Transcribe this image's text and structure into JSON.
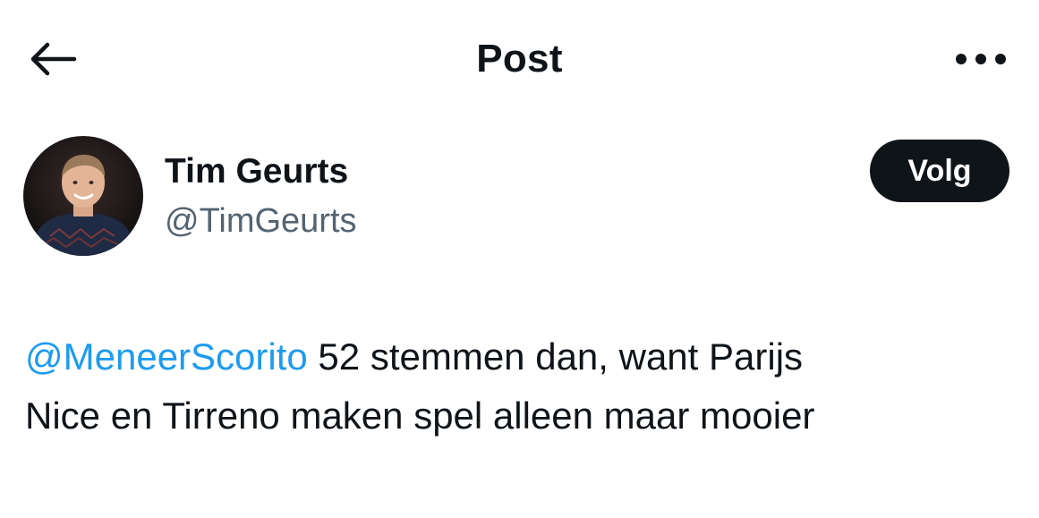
{
  "header": {
    "back_icon": "arrow-left-icon",
    "title": "Post",
    "more_icon": "more-horizontal-icon"
  },
  "author": {
    "avatar_icon": "user-avatar",
    "display_name": "Tim Geurts",
    "handle": "@TimGeurts",
    "follow_label": "Volg"
  },
  "post": {
    "mention": "@MeneerScorito",
    "text_line1": " 52 stemmen dan, want Parijs",
    "text_line2": "Nice en Tirreno maken spel alleen maar mooier"
  },
  "colors": {
    "text": "#0f1419",
    "secondary": "#536471",
    "link": "#1d9bf0",
    "button_bg": "#0f1419",
    "button_text": "#ffffff"
  }
}
